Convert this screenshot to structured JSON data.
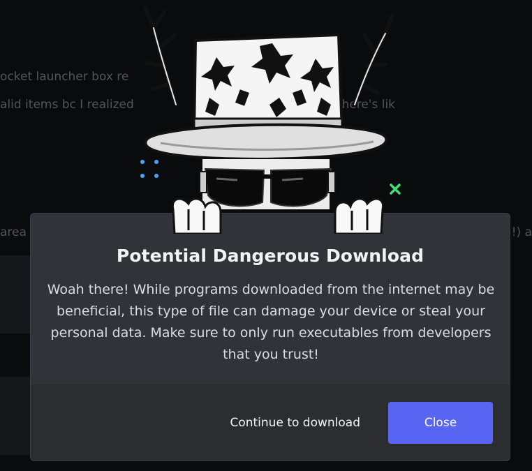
{
  "background": {
    "line1": "ocket launcher box re",
    "line2": "alid items bc I realized",
    "line2_tail": "on name there's lik",
    "line3": "area",
    "line3_tail": "!) a"
  },
  "modal": {
    "title": "Potential Dangerous Download",
    "description": "Woah there! While programs downloaded from the internet may be beneficial, this type of file can damage your device or steal your personal data. Make sure to only run executables from developers that you trust!",
    "continue_label": "Continue to download",
    "close_label": "Close"
  },
  "colors": {
    "modal_bg": "#313338",
    "footer_bg": "#2b2d31",
    "accent": "#5865f2",
    "sparkle_blue": "#4aa3ff",
    "sparkle_green": "#3ee07a"
  },
  "icons": {
    "mascot": "hat-mascot-icon",
    "sparkle_left": "sparkle-icon",
    "sparkle_right": "sparkle-x-icon"
  }
}
